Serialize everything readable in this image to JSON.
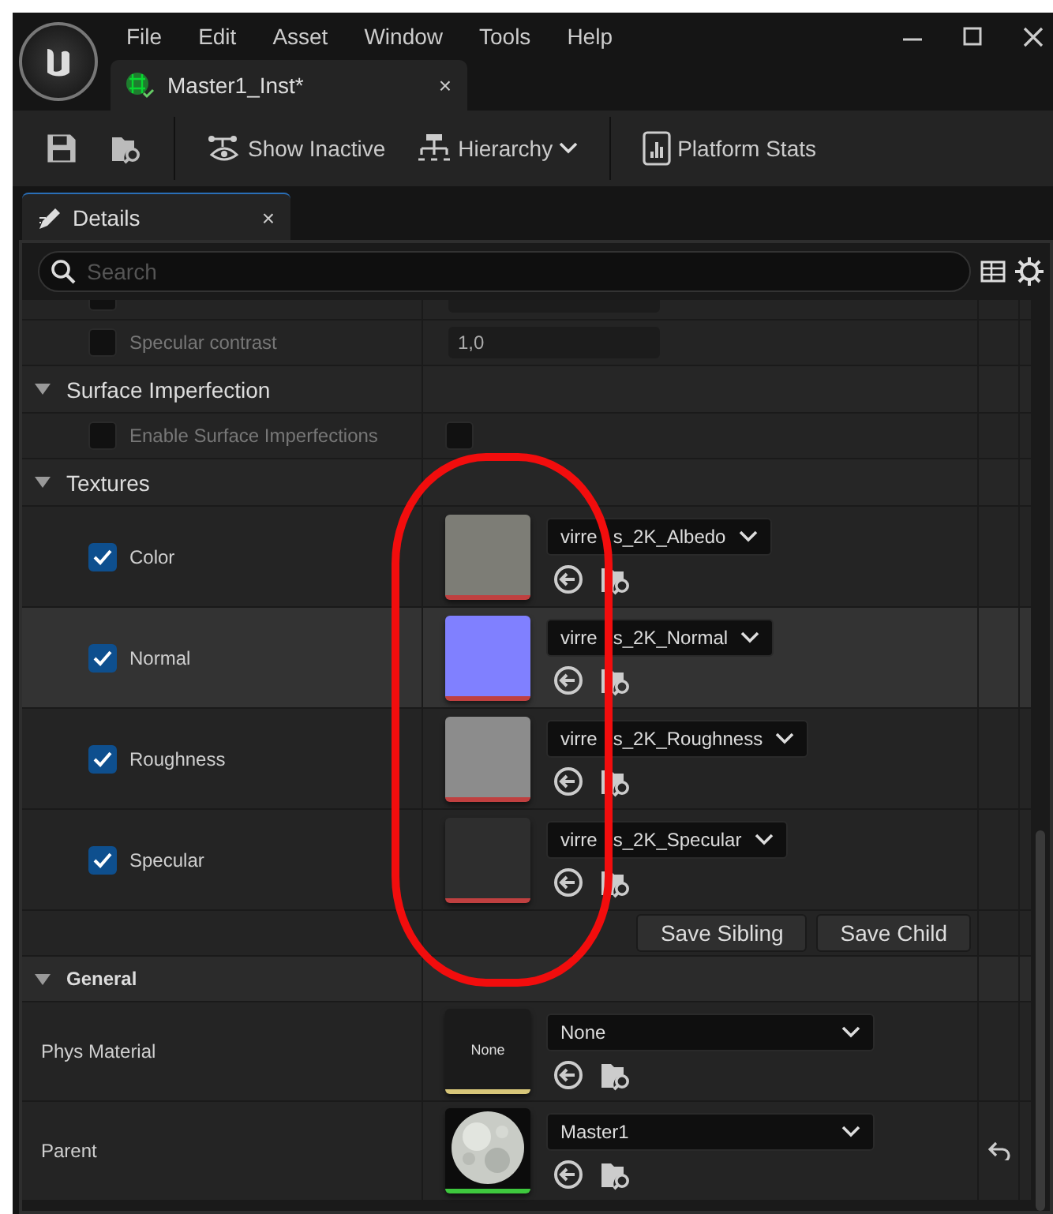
{
  "window": {
    "menu": [
      "File",
      "Edit",
      "Asset",
      "Window",
      "Tools",
      "Help"
    ],
    "document_tab": {
      "title": "Master1_Inst*",
      "close": "×"
    }
  },
  "toolbar": [
    {
      "kind": "save"
    },
    {
      "kind": "browse"
    },
    {
      "kind": "show_inactive",
      "label": "Show Inactive"
    },
    {
      "kind": "hierarchy",
      "label": "Hierarchy"
    },
    {
      "kind": "stats",
      "label": "Platform Stats"
    }
  ],
  "panel_tab": {
    "label": "Details",
    "close": "×"
  },
  "search": {
    "placeholder": "Search"
  },
  "rows": [
    {
      "kind": "cut_property",
      "checked": false
    },
    {
      "kind": "property",
      "label": "Specular contrast",
      "checked": false,
      "disabled": true,
      "value": "1,0"
    },
    {
      "kind": "group",
      "label": "Surface Imperfection",
      "expanded": true
    },
    {
      "kind": "property",
      "label": "Enable Surface Imperfections",
      "checked": false,
      "disabled": true,
      "value_checked": false
    },
    {
      "kind": "group",
      "label": "Textures",
      "expanded": true
    },
    {
      "kind": "texture",
      "label": "Color",
      "checked": true,
      "highlighted": false,
      "color": "#7d7d76",
      "asset_start": "virre",
      "asset_end": "s_2K_Albedo"
    },
    {
      "kind": "texture",
      "label": "Normal",
      "checked": true,
      "highlighted": true,
      "color": "#8080ff",
      "asset_start": "virre",
      "asset_end": "s_2K_Normal"
    },
    {
      "kind": "texture",
      "label": "Roughness",
      "checked": true,
      "highlighted": false,
      "color": "#8c8c8c",
      "asset_start": "virre",
      "asset_end": "s_2K_Roughness"
    },
    {
      "kind": "texture",
      "label": "Specular",
      "checked": true,
      "highlighted": false,
      "color": "#2e2e2e",
      "asset_start": "virre",
      "asset_end": "s_2K_Specular"
    },
    {
      "kind": "buttons",
      "buttons": [
        "Save Sibling",
        "Save Child"
      ]
    },
    {
      "kind": "category",
      "label": "General",
      "expanded": true
    },
    {
      "kind": "asset",
      "label": "Phys Material",
      "thumb_text": "None",
      "color": "#d8c77a",
      "value": "None",
      "reset": false
    },
    {
      "kind": "asset",
      "label": "Parent",
      "color": "#3ec83e",
      "value": "Master1",
      "reset": true
    }
  ],
  "annotation": {
    "kind": "ring"
  }
}
